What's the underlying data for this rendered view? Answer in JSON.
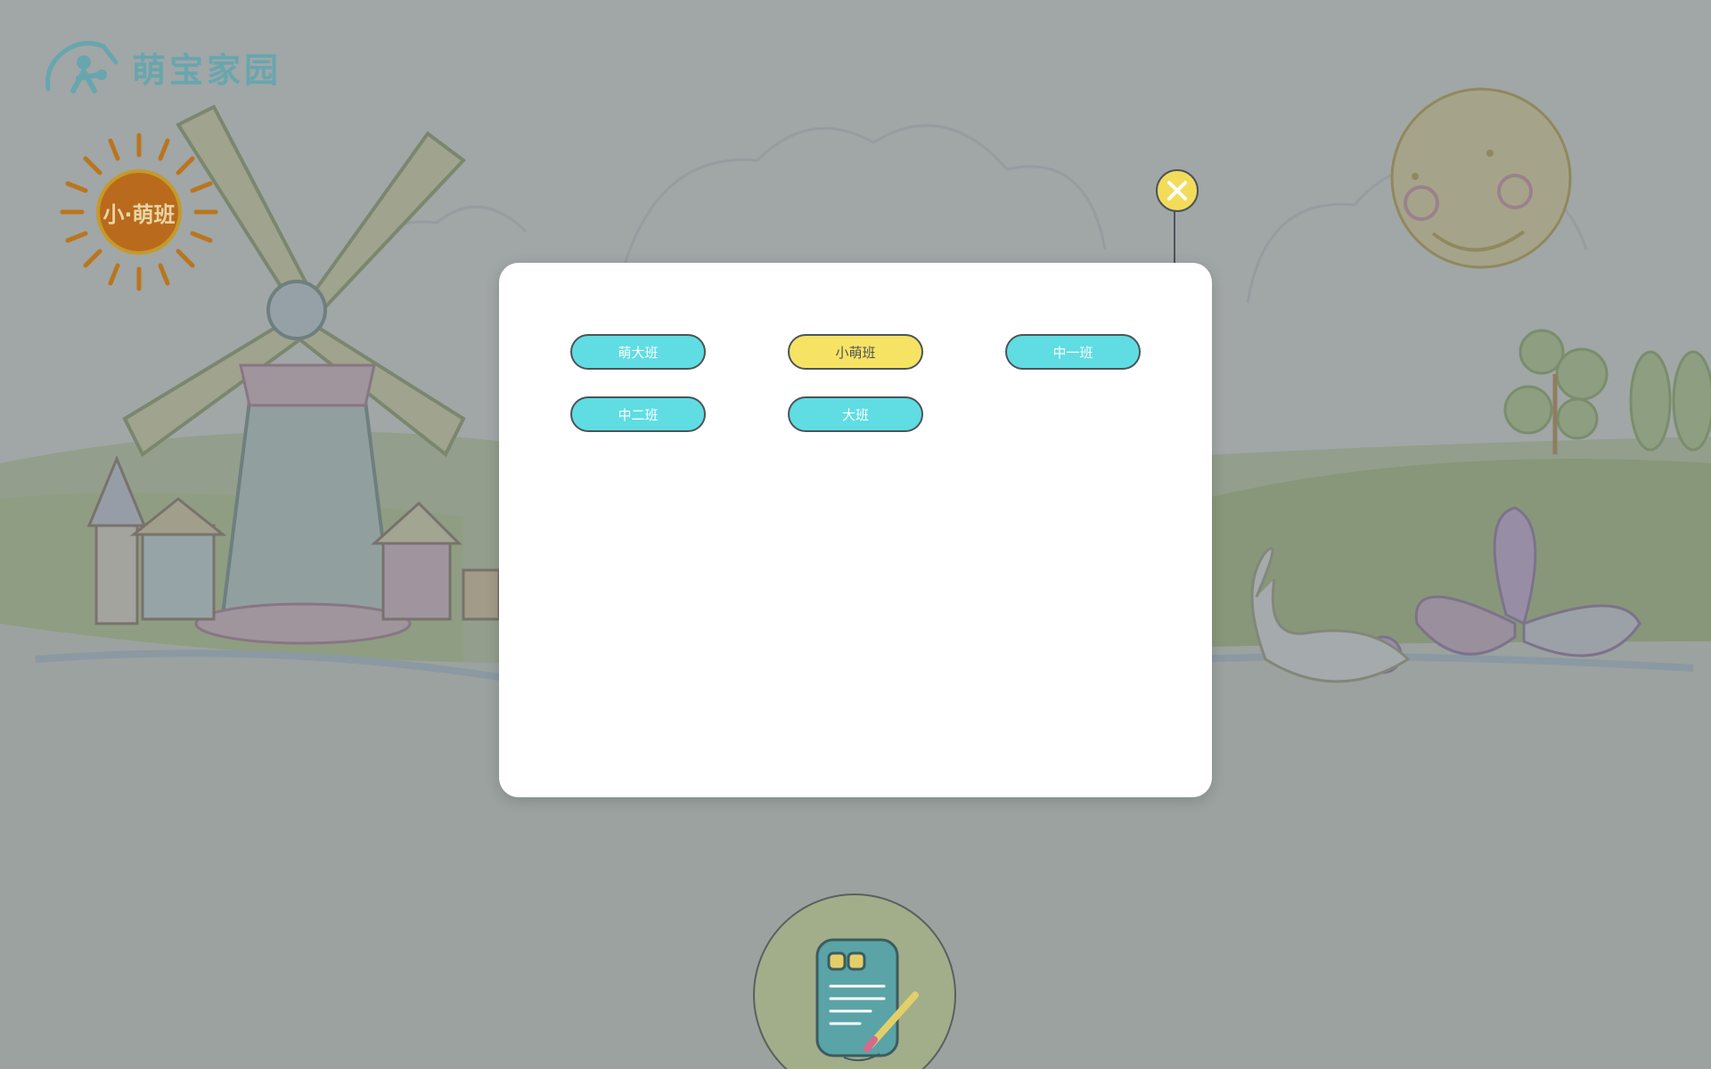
{
  "app": {
    "logo_text": "萌宝家园"
  },
  "badge": {
    "label": "小·萌班"
  },
  "dialog": {
    "close_icon": "close-icon",
    "classes": [
      {
        "label": "萌大班",
        "selected": false
      },
      {
        "label": "小萌班",
        "selected": true
      },
      {
        "label": "中一班",
        "selected": false
      },
      {
        "label": "中二班",
        "selected": false
      },
      {
        "label": "大班",
        "selected": false
      }
    ]
  },
  "bottom_action": {
    "icon": "sign-in-clipboard-icon"
  },
  "colors": {
    "class_button": "#5fdde3",
    "class_button_selected": "#f7e363",
    "close_button": "#f3dc5a",
    "overlay": "rgba(110,118,122,0.62)"
  }
}
